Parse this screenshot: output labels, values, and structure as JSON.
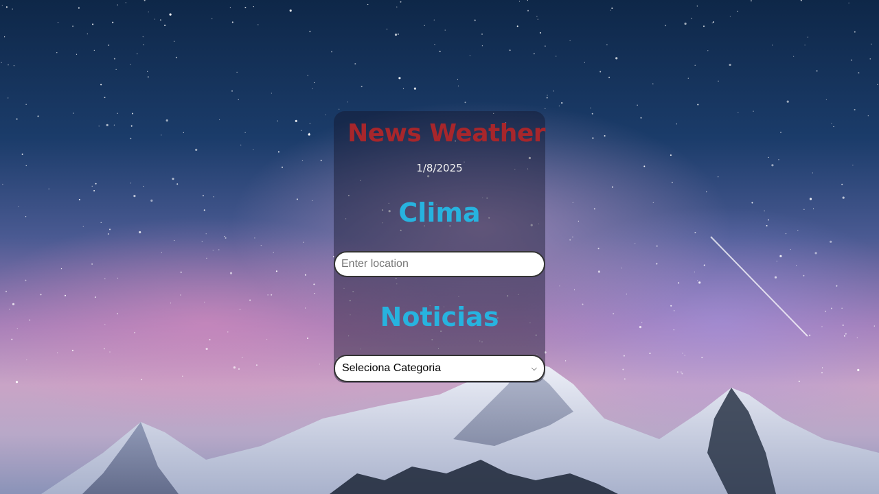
{
  "app": {
    "title": "News Weather",
    "date": "1/8/2025"
  },
  "weather": {
    "heading": "Clima",
    "location_placeholder": "Enter location",
    "location_value": ""
  },
  "news": {
    "heading": "Noticias",
    "category_selected": "Seleciona Categoria"
  },
  "colors": {
    "title": "#a8262b",
    "section_heading": "#27b3df",
    "date_text": "#f2f2f2"
  }
}
